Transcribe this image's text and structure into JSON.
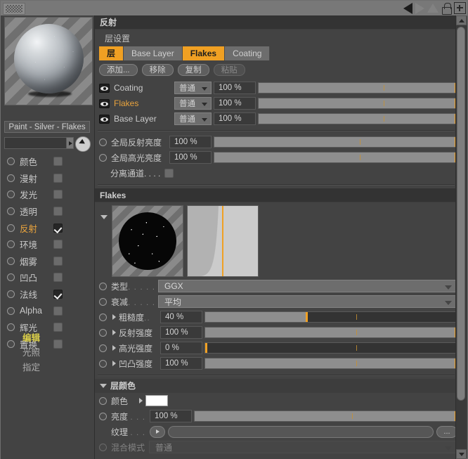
{
  "window": {
    "toolbar": {
      "grip_icon": "checker-grip-icon",
      "back_icon": "nav-back-icon",
      "forward_icon": "nav-forward-icon",
      "up_icon": "nav-up-icon",
      "lock_icon": "lock-icon",
      "add_icon": "plus-icon"
    }
  },
  "sidebar": {
    "material_name": "Paint - Silver - Flakes",
    "texture_field_value": "",
    "channels": [
      {
        "label": "颜色",
        "checked": false,
        "active": false
      },
      {
        "label": "漫射",
        "checked": false,
        "active": false
      },
      {
        "label": "发光",
        "checked": false,
        "active": false
      },
      {
        "label": "透明",
        "checked": false,
        "active": false
      },
      {
        "label": "反射",
        "checked": true,
        "active": true
      },
      {
        "label": "环境",
        "checked": false,
        "active": false
      },
      {
        "label": "烟雾",
        "checked": false,
        "active": false
      },
      {
        "label": "凹凸",
        "checked": false,
        "active": false
      },
      {
        "label": "法线",
        "checked": true,
        "active": false
      },
      {
        "label": "Alpha",
        "checked": false,
        "active": false
      },
      {
        "label": "辉光",
        "checked": false,
        "active": false
      },
      {
        "label": "置换",
        "checked": false,
        "active": false
      }
    ],
    "menus": [
      {
        "label": "编辑",
        "selected": true
      },
      {
        "label": "光照",
        "selected": false
      },
      {
        "label": "指定",
        "selected": false
      }
    ]
  },
  "panel": {
    "title": "反射",
    "layer_settings_label": "层设置",
    "tabs": [
      {
        "label": "层",
        "active": true
      },
      {
        "label": "Base Layer",
        "active": false
      },
      {
        "label": "Flakes",
        "active": true
      },
      {
        "label": "Coating",
        "active": false
      }
    ],
    "buttons": [
      {
        "label": "添加...",
        "enabled": true
      },
      {
        "label": "移除",
        "enabled": true
      },
      {
        "label": "复制",
        "enabled": true
      },
      {
        "label": "粘贴",
        "enabled": false
      }
    ],
    "layers": [
      {
        "name": "Coating",
        "mode": "普通",
        "opacity": "100 %",
        "highlight": false,
        "fill_pct": 100
      },
      {
        "name": "Flakes",
        "mode": "普通",
        "opacity": "100 %",
        "highlight": true,
        "fill_pct": 100
      },
      {
        "name": "Base Layer",
        "mode": "普通",
        "opacity": "100 %",
        "highlight": false,
        "fill_pct": 100
      }
    ],
    "globals": [
      {
        "label": "全局反射亮度",
        "value": "100 %",
        "fill_pct": 100
      },
      {
        "label": "全局高光亮度",
        "value": "100 %",
        "fill_pct": 100
      }
    ],
    "separate_channel": {
      "label": "分离通道. . . .",
      "checked": false
    },
    "flakes": {
      "title": "Flakes",
      "thumb_flakes_name": "flakes-preview-thumbnail",
      "thumb_curve_name": "falloff-curve-thumbnail",
      "params": [
        {
          "label": "类型",
          "dots": ". . . . .",
          "type": "select",
          "value": "GGX"
        },
        {
          "label": "衰减",
          "dots": ". . . . .",
          "type": "select",
          "value": "平均"
        },
        {
          "label": "粗糙度",
          "dots": "..",
          "type": "slider",
          "value": "40 %",
          "fill_pct": 40
        },
        {
          "label": "反射强度",
          "dots": "",
          "type": "slider",
          "value": "100 %",
          "fill_pct": 100
        },
        {
          "label": "高光强度",
          "dots": "",
          "type": "slider",
          "value": "0 %",
          "fill_pct": 0
        },
        {
          "label": "凹凸强度",
          "dots": "",
          "type": "slider",
          "value": "100 %",
          "fill_pct": 100
        }
      ]
    },
    "layer_color": {
      "title": "层颜色",
      "color_label": "颜色",
      "color_value": "#ffffff",
      "brightness_label": "亮度",
      "brightness_dots": ". . .",
      "brightness_value": "100 %",
      "brightness_fill_pct": 100,
      "texture_label": "纹理",
      "texture_dots": ". . .",
      "texture_value": "",
      "texture_browse_label": "...",
      "blend_label": "混合模式",
      "blend_value": "普通"
    }
  },
  "colors": {
    "accent": "#f0a023",
    "highlight_text": "#e8a33d",
    "menu_selected": "#d9cd4a",
    "panel_bg": "#434343",
    "header_bg": "#333333"
  }
}
